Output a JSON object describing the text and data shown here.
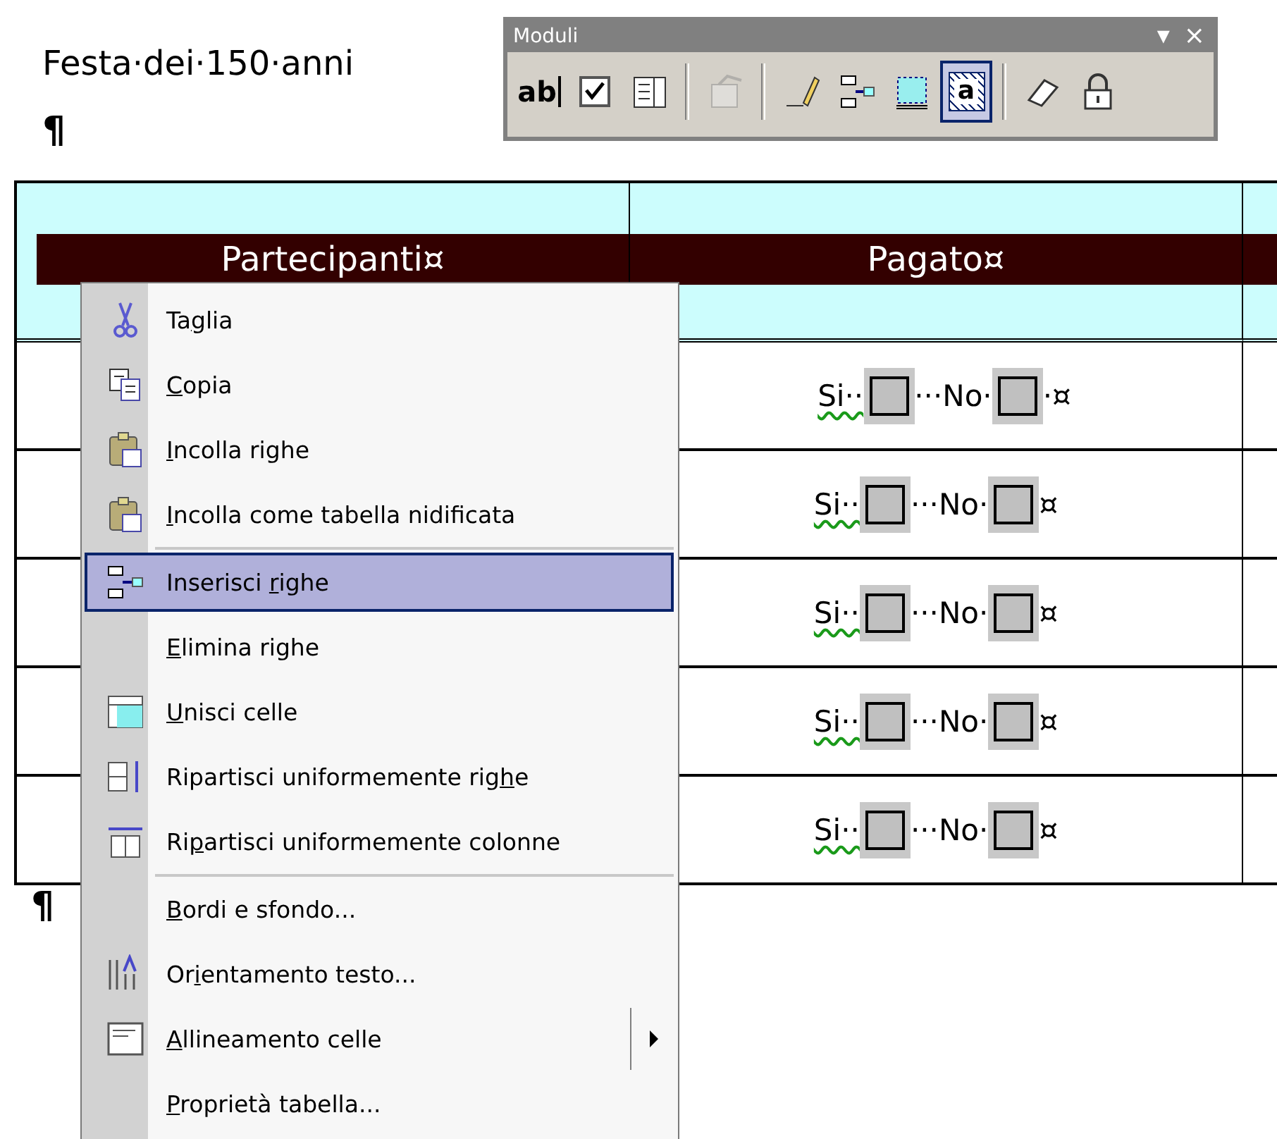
{
  "document": {
    "title": "Festa·dei·150·anni",
    "paragraph_marks": [
      "¶",
      "¶"
    ]
  },
  "table": {
    "headers": [
      "Partecipanti¤",
      "Pagato¤"
    ],
    "rows": [
      {
        "yes_label": "Si··",
        "no_label": "···No·",
        "end_mark": "·¤",
        "misspelled": true,
        "yes_checked": false,
        "no_checked": false
      },
      {
        "yes_label": "Si··",
        "no_label": "···No·",
        "end_mark": "¤",
        "misspelled": true,
        "yes_checked": false,
        "no_checked": false
      },
      {
        "yes_label": "Si··",
        "no_label": "···No·",
        "end_mark": "¤",
        "misspelled": true,
        "yes_checked": false,
        "no_checked": false
      },
      {
        "yes_label": "Si··",
        "no_label": "···No·",
        "end_mark": "¤",
        "misspelled": true,
        "yes_checked": false,
        "no_checked": false
      },
      {
        "yes_label": "Si··",
        "no_label": "···No·",
        "end_mark": "¤",
        "misspelled": true,
        "yes_checked": false,
        "no_checked": false
      }
    ]
  },
  "toolbar": {
    "title": "Moduli",
    "menu_glyph": "▾",
    "close_glyph": "×",
    "buttons": [
      {
        "kind": "text-field",
        "label": "ab",
        "selected": false,
        "disabled": false,
        "group_end": false
      },
      {
        "kind": "checkbox",
        "selected": false,
        "disabled": false,
        "group_end": false
      },
      {
        "kind": "dropdown",
        "selected": false,
        "disabled": false,
        "group_end": true
      },
      {
        "kind": "properties",
        "selected": false,
        "disabled": true,
        "group_end": true
      },
      {
        "kind": "draw-table",
        "selected": false,
        "disabled": false,
        "group_end": false
      },
      {
        "kind": "insert-rows",
        "selected": false,
        "disabled": false,
        "group_end": false
      },
      {
        "kind": "insert-frame",
        "selected": false,
        "disabled": false,
        "group_end": false
      },
      {
        "kind": "shading",
        "label": "a",
        "selected": true,
        "disabled": false,
        "group_end": true
      },
      {
        "kind": "eraser",
        "selected": false,
        "disabled": false,
        "group_end": false
      },
      {
        "kind": "lock",
        "selected": false,
        "disabled": false,
        "group_end": false
      }
    ]
  },
  "context_menu": {
    "items": [
      {
        "prefix": "Ta",
        "key": "g",
        "suffix": "lia",
        "selected": false,
        "separator_before": false,
        "submenu": false
      },
      {
        "key": "C",
        "suffix": "opia",
        "selected": false,
        "separator_before": false,
        "submenu": false
      },
      {
        "key": "I",
        "suffix": "ncolla righe",
        "selected": false,
        "separator_before": false,
        "submenu": false
      },
      {
        "key": "I",
        "suffix": "ncolla come tabella nidificata",
        "selected": false,
        "separator_before": false,
        "submenu": false
      },
      {
        "prefix": "Inserisci ",
        "key": "r",
        "suffix": "ighe",
        "selected": true,
        "separator_before": true,
        "submenu": false
      },
      {
        "key": "E",
        "suffix": "limina righe",
        "selected": false,
        "separator_before": false,
        "submenu": false
      },
      {
        "key": "U",
        "suffix": "nisci celle",
        "selected": false,
        "separator_before": false,
        "submenu": false
      },
      {
        "prefix": "Ripartisci uniformemente rig",
        "key": "h",
        "suffix": "e",
        "selected": false,
        "separator_before": false,
        "submenu": false
      },
      {
        "prefix": "Ri",
        "key": "p",
        "suffix": "artisci uniformemente colonne",
        "selected": false,
        "separator_before": false,
        "submenu": false
      },
      {
        "key": "B",
        "suffix": "ordi e sfondo...",
        "selected": false,
        "separator_before": true,
        "submenu": false
      },
      {
        "prefix": "Or",
        "key": "i",
        "suffix": "entamento testo...",
        "selected": false,
        "separator_before": false,
        "submenu": false
      },
      {
        "key": "A",
        "suffix": "llineamento celle",
        "selected": false,
        "separator_before": false,
        "submenu": true
      },
      {
        "key": "P",
        "suffix": "roprietà tabella...",
        "selected": false,
        "separator_before": false,
        "submenu": false
      }
    ]
  }
}
